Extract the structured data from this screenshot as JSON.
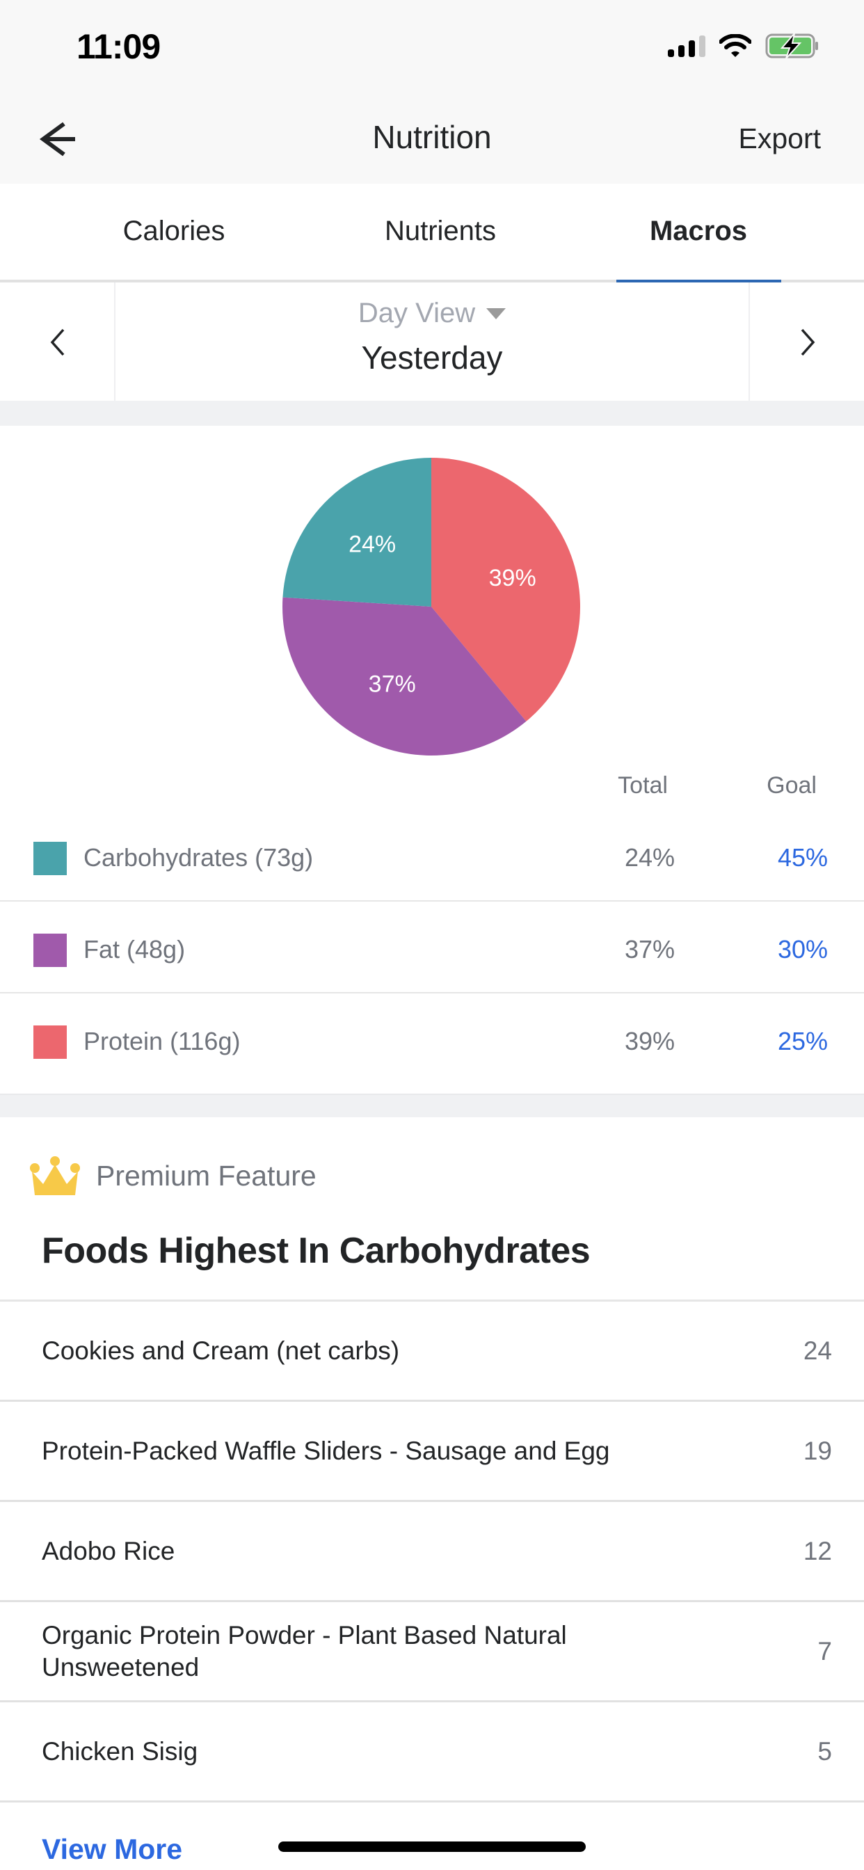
{
  "status_bar": {
    "time": "11:09",
    "signal_bars_active": 3,
    "signal_bars_total": 4,
    "wifi_icon": "wifi-icon",
    "battery_icon": "battery-charging-icon",
    "battery_color": "#65c466"
  },
  "nav": {
    "back_icon": "arrow-left-icon",
    "title": "Nutrition",
    "export_label": "Export"
  },
  "tabs": [
    {
      "label": "Calories",
      "active": false
    },
    {
      "label": "Nutrients",
      "active": false
    },
    {
      "label": "Macros",
      "active": true
    }
  ],
  "accent_color": "#2c67b3",
  "date_switcher": {
    "prev_icon": "chevron-left-icon",
    "next_icon": "chevron-right-icon",
    "view_mode": "Day View",
    "date_label": "Yesterday"
  },
  "chart_data": {
    "type": "pie",
    "title": "",
    "start_angle": "12 o'clock, clockwise",
    "slices": [
      {
        "name": "Protein",
        "value": 39,
        "label": "39%",
        "color": "#ec676e"
      },
      {
        "name": "Fat",
        "value": 37,
        "label": "37%",
        "color": "#a05aab"
      },
      {
        "name": "Carbohydrates",
        "value": 24,
        "label": "24%",
        "color": "#4aa3ab"
      }
    ]
  },
  "macros_table": {
    "headers": {
      "total": "Total",
      "goal": "Goal"
    },
    "rows": [
      {
        "label": "Carbohydrates (73g)",
        "total": "24%",
        "goal": "45%",
        "color": "#4aa3ab"
      },
      {
        "label": "Fat (48g)",
        "total": "37%",
        "goal": "30%",
        "color": "#a05aab"
      },
      {
        "label": "Protein (116g)",
        "total": "39%",
        "goal": "25%",
        "color": "#ec676e"
      }
    ]
  },
  "premium": {
    "badge_icon": "crown-icon",
    "badge_label": "Premium Feature",
    "title": "Foods Highest In Carbohydrates",
    "foods": [
      {
        "name": "Cookies and Cream (net carbs)",
        "value": "24"
      },
      {
        "name": "Protein-Packed Waffle Sliders - Sausage and Egg",
        "value": "19"
      },
      {
        "name": "Adobo Rice",
        "value": "12"
      },
      {
        "name": "Organic Protein Powder - Plant Based Natural Unsweetened",
        "value": "7"
      },
      {
        "name": "Chicken Sisig",
        "value": "5"
      }
    ],
    "view_more_label": "View More"
  }
}
